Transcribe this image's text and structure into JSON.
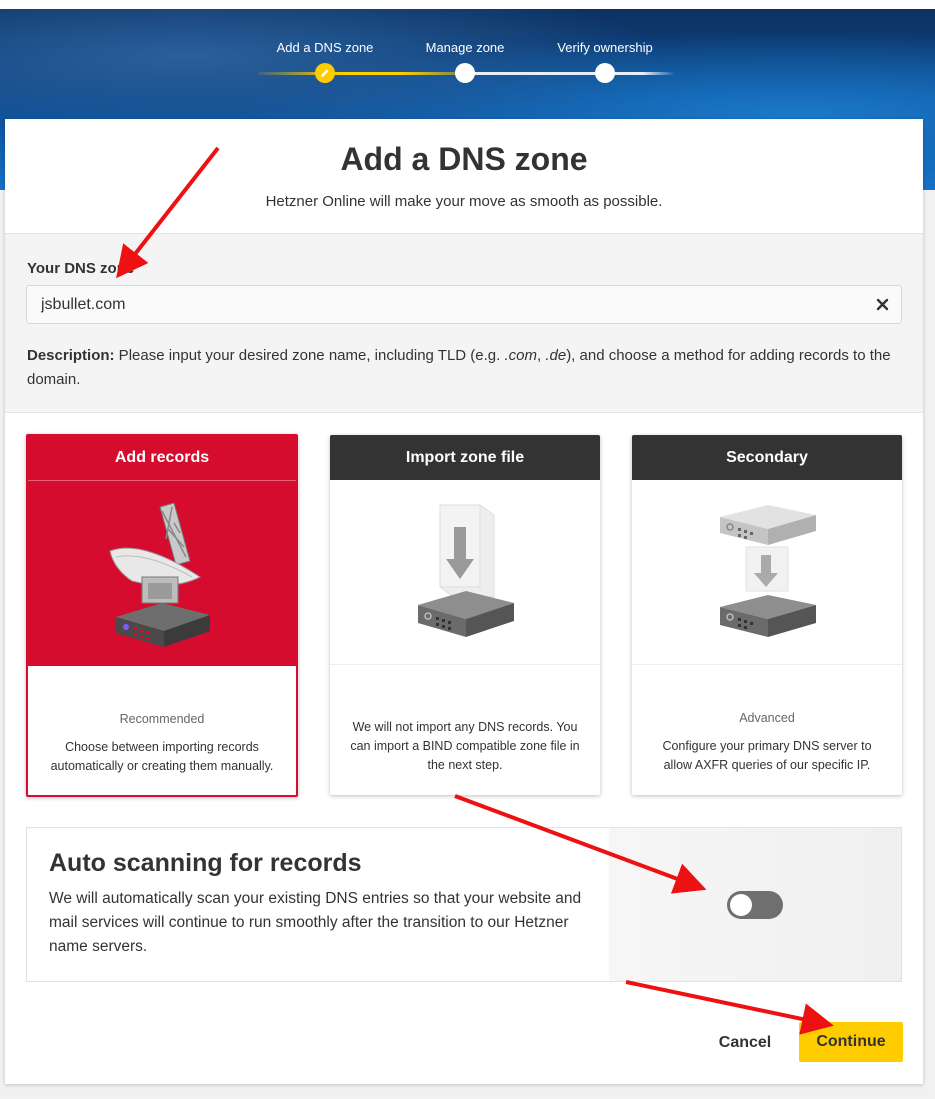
{
  "stepper": {
    "steps": [
      {
        "label": "Add a DNS zone",
        "state": "active"
      },
      {
        "label": "Manage zone",
        "state": "todo"
      },
      {
        "label": "Verify ownership",
        "state": "todo"
      }
    ]
  },
  "header": {
    "title": "Add a DNS zone",
    "subtitle": "Hetzner Online will make your move as smooth as possible."
  },
  "zone": {
    "label": "Your DNS zone",
    "value": "jsbullet.com",
    "clear_icon": "close-icon",
    "description_lead": "Description:",
    "description_a": " Please input your desired zone name, including TLD (e.g. ",
    "tld_com": ".com",
    "description_sep": ", ",
    "tld_de": ".de",
    "description_b": "), and choose a method for adding records to the domain."
  },
  "options": [
    {
      "title": "Add records",
      "tag": "Recommended",
      "text": "Choose between importing records automatically or creating them manually.",
      "selected": true,
      "icon": "satellite-dish-icon"
    },
    {
      "title": "Import zone file",
      "tag": "",
      "text": "We will not import any DNS records. You can import a BIND compatible zone file in the next step.",
      "selected": false,
      "icon": "import-server-icon"
    },
    {
      "title": "Secondary",
      "tag": "Advanced",
      "text": "Configure your primary DNS server to allow AXFR queries of our specific IP.",
      "selected": false,
      "icon": "server-transfer-icon"
    }
  ],
  "auto_scan": {
    "title": "Auto scanning for records",
    "description": "We will automatically scan your existing DNS entries so that your website and mail services will continue to run smoothly after the transition to our Hetzner name servers.",
    "enabled": false
  },
  "actions": {
    "cancel_label": "Cancel",
    "continue_label": "Continue"
  },
  "colors": {
    "accent_yellow": "#ffcc00",
    "selected_red": "#d50c2d",
    "header_dark": "#333333",
    "annotation_arrow": "#ee1111"
  }
}
